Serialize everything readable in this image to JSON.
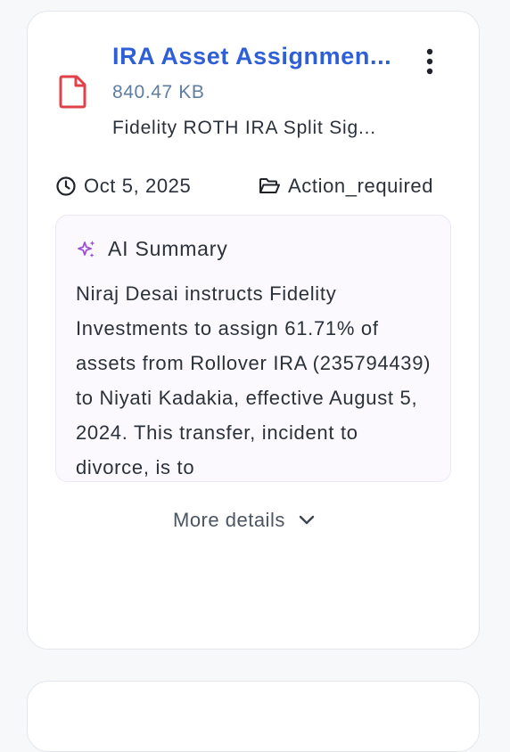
{
  "document": {
    "title": "IRA Asset Assignmen...",
    "file_size": "840.47 KB",
    "description": "Fidelity ROTH IRA Split Sig...",
    "date": "Oct 5, 2025",
    "status": "Action_required",
    "file_icon": "file-icon",
    "file_icon_color": "#e0424a"
  },
  "summary": {
    "heading": "AI Summary",
    "icon": "sparkles-icon",
    "icon_color": "#9b4dd8",
    "text": "Niraj Desai instructs Fidelity Investments to assign 61.71% of assets from Rollover IRA (235794439) to Niyati Kadakia, effective August 5, 2024. This transfer, incident to divorce, is to"
  },
  "actions": {
    "more_details_label": "More details",
    "menu_icon": "more-vertical-icon"
  },
  "colors": {
    "title": "#2f5fd6",
    "file_size": "#5f7e9f",
    "text": "#2b313a"
  }
}
